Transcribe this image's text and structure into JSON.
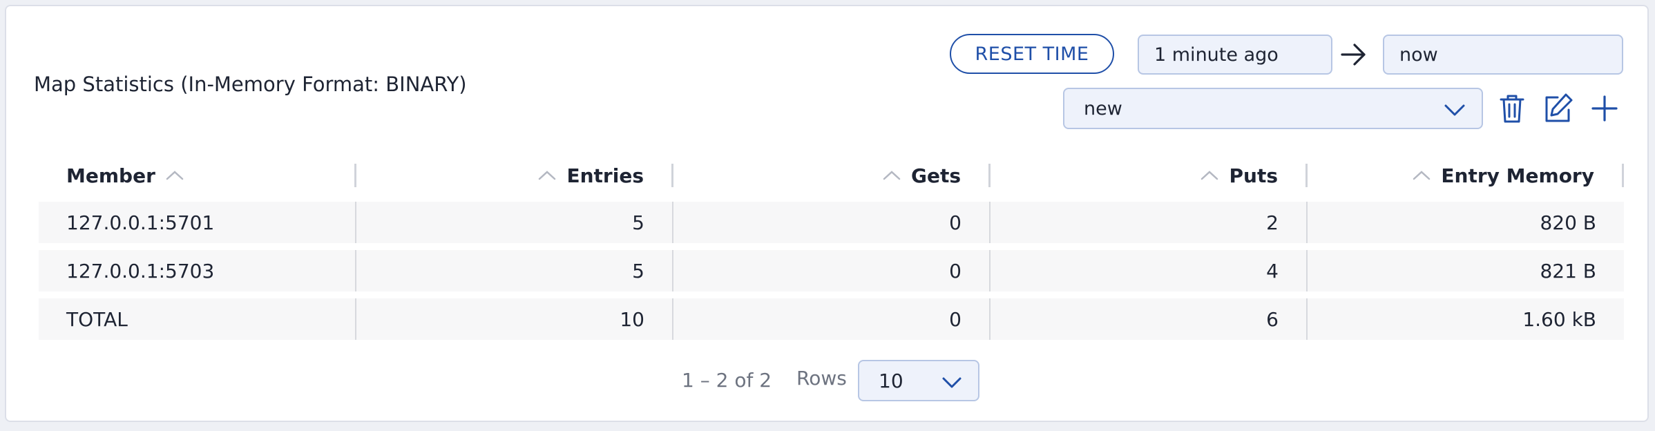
{
  "panel": {
    "title": "Map Statistics (In-Memory Format: BINARY)"
  },
  "toolbar": {
    "reset_label": "RESET TIME",
    "time_from": "1 minute ago",
    "time_to": "now",
    "filter_selected": "new",
    "icons": [
      "trash-icon",
      "edit-icon",
      "plus-icon",
      "arrow-right-icon",
      "chevron-down-icon"
    ]
  },
  "table": {
    "columns": [
      "Member",
      "Entries",
      "Gets",
      "Puts",
      "Entry Memory"
    ],
    "rows": [
      [
        "127.0.0.1:5701",
        "5",
        "0",
        "2",
        "820 B"
      ],
      [
        "127.0.0.1:5703",
        "5",
        "0",
        "4",
        "821 B"
      ],
      [
        "TOTAL",
        "10",
        "0",
        "6",
        "1.60 kB"
      ]
    ]
  },
  "pagination": {
    "range": "1 – 2 of 2",
    "rows_label": "Rows",
    "rows_per_page": "10"
  },
  "colors": {
    "accent": "#1f4fa8",
    "field_bg": "#eef2fb",
    "row_bg": "#f7f7f8"
  }
}
